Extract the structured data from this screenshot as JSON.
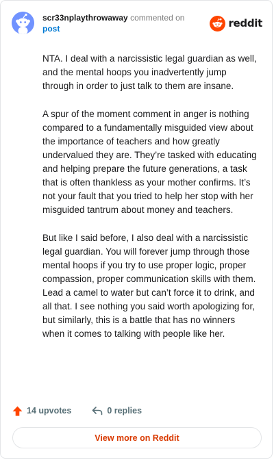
{
  "header": {
    "username": "scr33nplaythrowaway",
    "action_text": "commented on",
    "post_link": "post",
    "brand": "reddit"
  },
  "comment": {
    "paragraphs": [
      "NTA. I deal with a narcissistic legal guardian as well, and the mental hoops you inadvertently jump through in order to just talk to them are insane.",
      "A spur of the moment comment in anger is nothing compared to a fundamentally misguided view about the importance of teachers and how greatly undervalued they are. They’re tasked with educating and helping prepare the future generations, a task that is often thankless as your mother confirms. It’s not your fault that you tried to help her stop with her misguided tantrum about money and teachers.",
      "But like I said before, I also deal with a narcissistic legal guardian. You will forever jump through those mental hoops if you try to use proper logic, proper compassion, proper communication skills with them. Lead a camel to water but can’t force it to drink, and all that. I see nothing you said worth apologizing for, but similarly, this is a battle that has no winners when it comes to talking with people like her."
    ]
  },
  "actions": {
    "upvotes": "14 upvotes",
    "replies": "0 replies"
  },
  "footer": {
    "view_more_label": "View more on Reddit"
  },
  "colors": {
    "brand_orange": "#ff4500",
    "link_blue": "#0079d3",
    "view_more_red": "#d93900",
    "avatar_blue": "#7193ff"
  },
  "icons": {
    "avatar": "snoo-avatar-icon",
    "brand": "reddit-logo-icon",
    "upvote": "upvote-arrow-icon",
    "reply": "reply-arrow-icon"
  }
}
